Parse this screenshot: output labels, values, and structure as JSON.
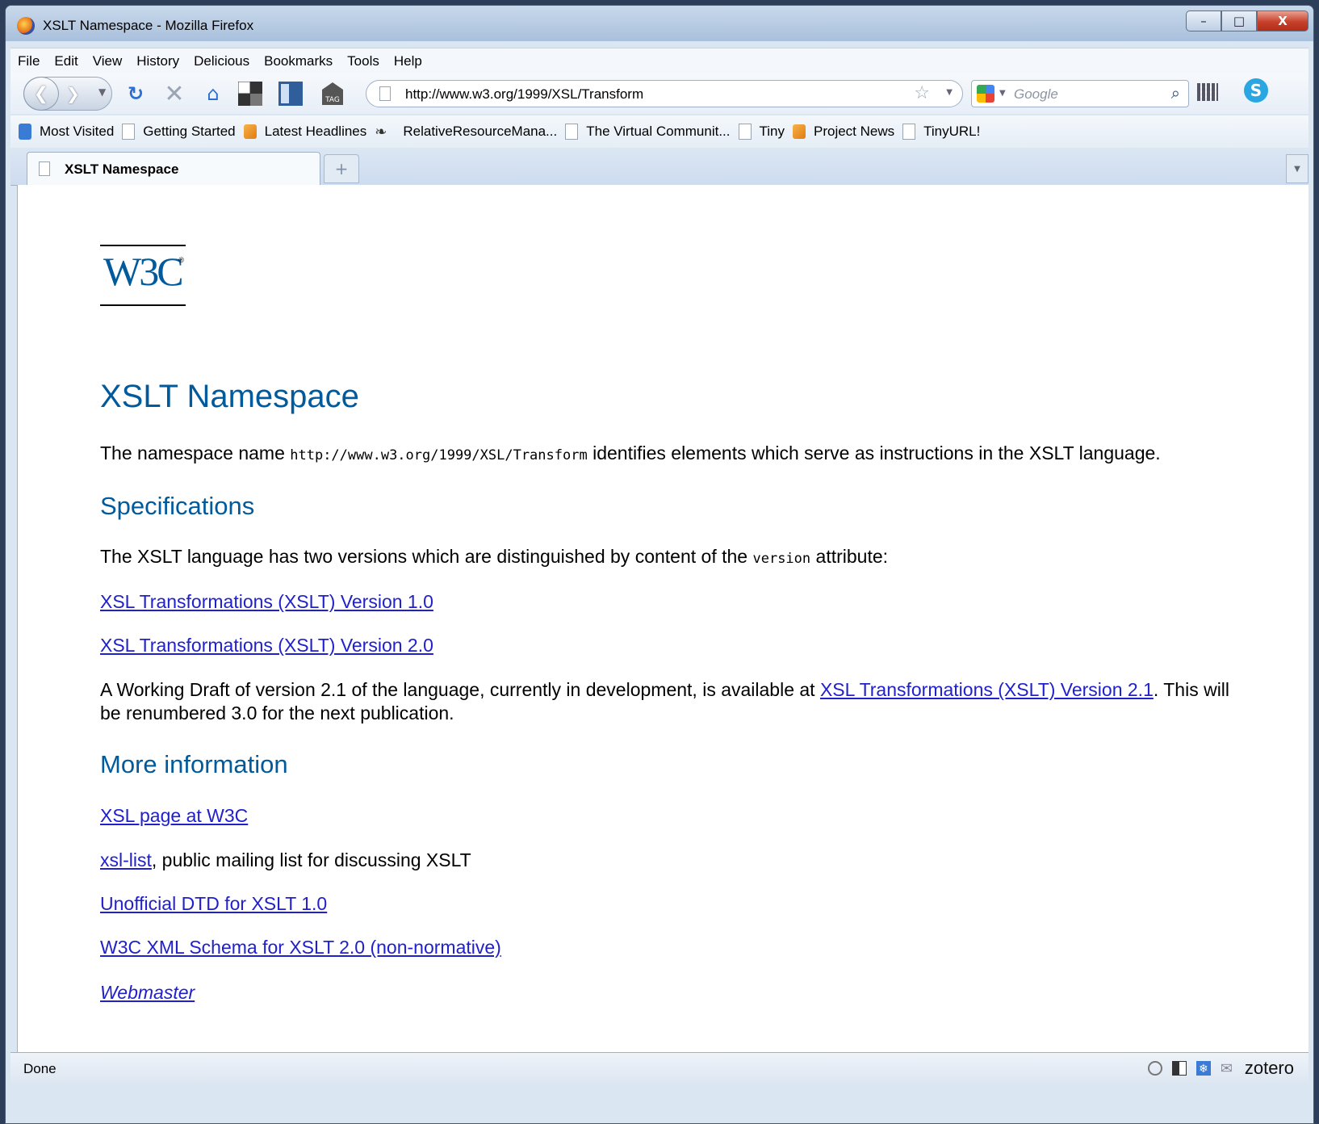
{
  "window": {
    "title": "XSLT Namespace - Mozilla Firefox",
    "min": "–",
    "max": "□",
    "close": "X"
  },
  "menu": [
    "File",
    "Edit",
    "View",
    "History",
    "Delicious",
    "Bookmarks",
    "Tools",
    "Help"
  ],
  "toolbar": {
    "url": "http://www.w3.org/1999/XSL/Transform",
    "search_placeholder": "Google"
  },
  "bookmarks": [
    {
      "label": "Most Visited",
      "icon": "most-visited-icon"
    },
    {
      "label": "Getting Started",
      "icon": "page-icon"
    },
    {
      "label": "Latest Headlines",
      "icon": "rss-feed-icon"
    },
    {
      "label": "RelativeResourceMana...",
      "icon": "relativeresource-icon"
    },
    {
      "label": "The Virtual Communit...",
      "icon": "page-icon"
    },
    {
      "label": "Tiny",
      "icon": "page-icon"
    },
    {
      "label": "Project News",
      "icon": "rss-feed-icon"
    },
    {
      "label": "TinyURL!",
      "icon": "page-icon"
    }
  ],
  "tab": {
    "label": "XSLT Namespace",
    "new_tab": "+"
  },
  "page": {
    "logo": "W3C",
    "title": "XSLT Namespace",
    "intro_before": "The namespace name ",
    "intro_code": "http://www.w3.org/1999/XSL/Transform",
    "intro_after": " identifies elements which serve as instructions in the XSLT language.",
    "spec_heading": "Specifications",
    "spec_before": "The XSLT language has two versions which are distinguished by content of the ",
    "spec_code": "version",
    "spec_after": " attribute:",
    "link_v1": "XSL Transformations (XSLT) Version 1.0",
    "link_v2": "XSL Transformations (XSLT) Version 2.0",
    "draft_before": "A Working Draft of version 2.1 of the language, currently in development, is available at ",
    "draft_link": "XSL Transformations (XSLT) Version 2.1",
    "draft_after": ". This will be renumbered 3.0 for the next publication.",
    "more_heading": "More information",
    "link_xsl_page": "XSL page at W3C",
    "link_xsl_list": "xsl-list",
    "xsl_list_after": ", public mailing list for discussing XSLT",
    "link_dtd": "Unofficial DTD for XSLT 1.0",
    "link_schema": "W3C XML Schema for XSLT 2.0 (non-normative)",
    "link_webmaster": "Webmaster"
  },
  "status": {
    "text": "Done",
    "zotero": "zotero"
  }
}
